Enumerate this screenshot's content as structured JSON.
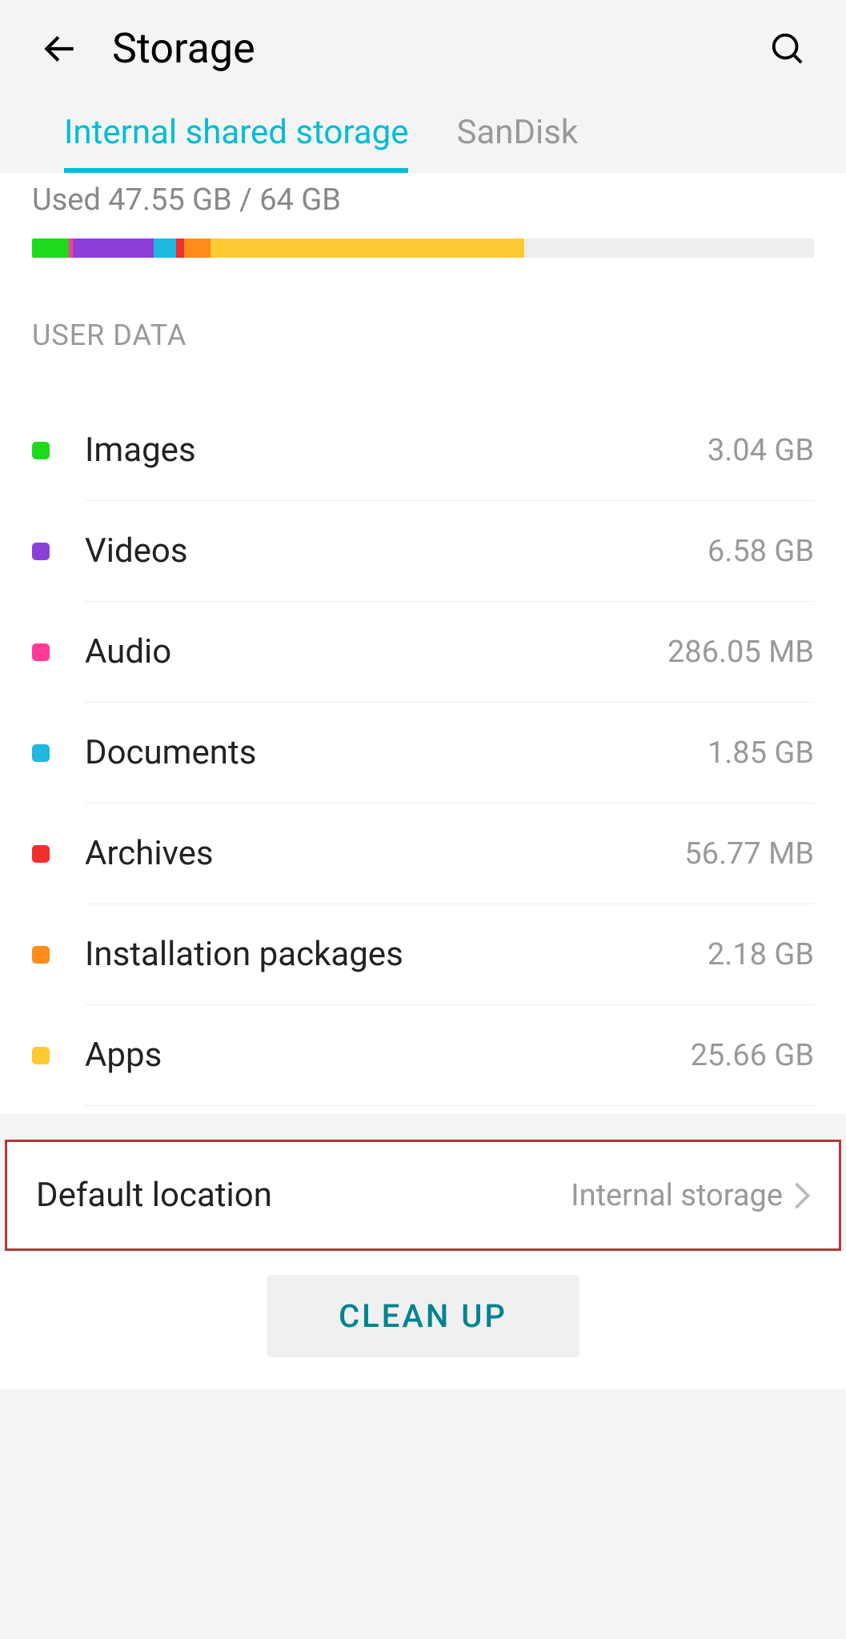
{
  "header": {
    "title": "Storage"
  },
  "tabs": {
    "internal": "Internal shared storage",
    "sandisk": "SanDisk"
  },
  "usage": {
    "text": "Used 47.55 GB / 64 GB"
  },
  "section_header": "USER DATA",
  "categories": [
    {
      "name": "Images",
      "size": "3.04 GB",
      "color": "#1fd91f"
    },
    {
      "name": "Videos",
      "size": "6.58 GB",
      "color": "#8c3fd8"
    },
    {
      "name": "Audio",
      "size": "286.05 MB",
      "color": "#ff3b9a"
    },
    {
      "name": "Documents",
      "size": "1.85 GB",
      "color": "#1eb8e0"
    },
    {
      "name": "Archives",
      "size": "56.77 MB",
      "color": "#f02e2e"
    },
    {
      "name": "Installation packages",
      "size": "2.18 GB",
      "color": "#ff8c1a"
    },
    {
      "name": "Apps",
      "size": "25.66 GB",
      "color": "#ffc933"
    }
  ],
  "bar_segments": [
    {
      "color": "#1fd91f",
      "width": "4.75%"
    },
    {
      "color": "#ff3b9a",
      "width": "0.5%"
    },
    {
      "color": "#8c3fd8",
      "width": "10.28%"
    },
    {
      "color": "#1eb8e0",
      "width": "2.9%"
    },
    {
      "color": "#f02e2e",
      "width": "1%"
    },
    {
      "color": "#ff8c1a",
      "width": "3.4%"
    },
    {
      "color": "#ffc933",
      "width": "40.1%"
    }
  ],
  "default_location": {
    "label": "Default location",
    "value": "Internal storage"
  },
  "cleanup_label": "CLEAN UP"
}
